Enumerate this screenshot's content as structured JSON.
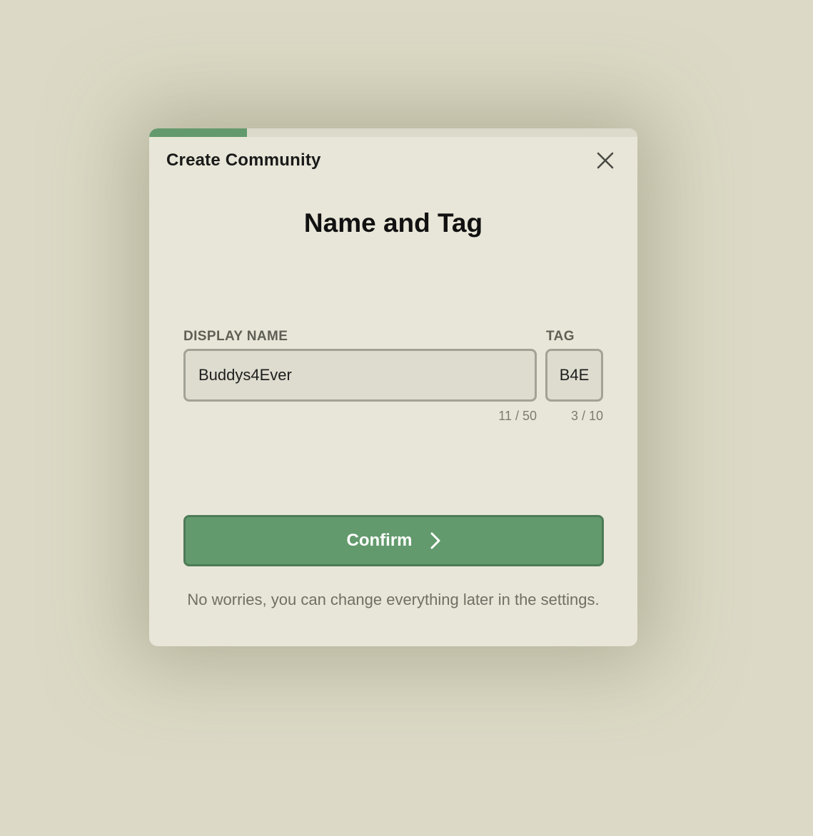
{
  "modal": {
    "title": "Create Community",
    "progress_fraction": 0.2
  },
  "step": {
    "heading": "Name and Tag"
  },
  "display_name": {
    "label": "DISPLAY NAME",
    "value": "Buddys4Ever",
    "counter": "11 / 50"
  },
  "tag": {
    "label": "TAG",
    "value": "B4E",
    "counter": "3 / 10"
  },
  "actions": {
    "confirm_label": "Confirm"
  },
  "footer": {
    "note": "No worries, you can change everything later in the settings."
  },
  "icons": {
    "close": "close-icon",
    "confirm_arrow": "chevron-right-icon"
  },
  "colors": {
    "accent": "#639a6d",
    "background": "#dcdac6",
    "surface": "#e8e6d8"
  }
}
